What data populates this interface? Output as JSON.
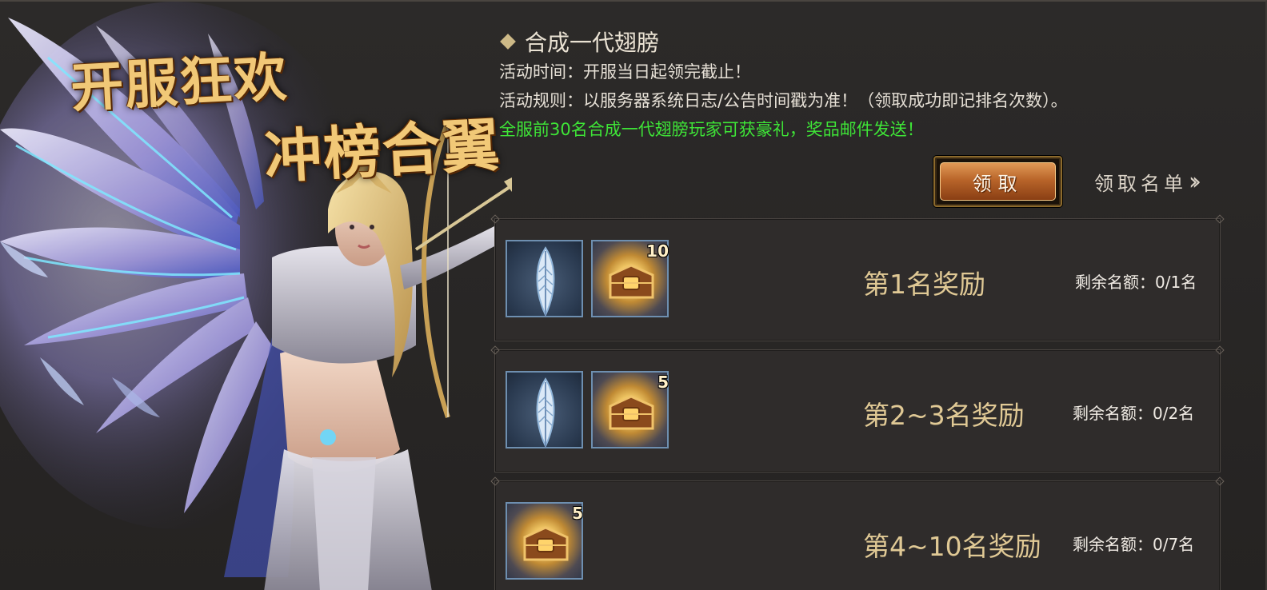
{
  "banner": {
    "line1": "开服狂欢",
    "line2": "冲榜合翼"
  },
  "activity": {
    "title": "合成一代翅膀",
    "time": "活动时间：开服当日起领完截止！",
    "rule": "活动规则：以服务器系统日志/公告时间戳为准！（领取成功即记排名次数）。",
    "reward_note": "全服前30名合成一代翅膀玩家可获豪礼，奖品邮件发送！"
  },
  "actions": {
    "claim_label": "领取",
    "list_label": "领取名单"
  },
  "rewards": [
    {
      "rank_label": "第1名奖励",
      "remaining": "剩余名额：0/1名",
      "items": [
        {
          "icon": "feather-icon",
          "count": ""
        },
        {
          "icon": "treasure-chest-icon",
          "count": "10"
        }
      ]
    },
    {
      "rank_label": "第2~3名奖励",
      "remaining": "剩余名额：0/2名",
      "items": [
        {
          "icon": "feather-icon",
          "count": ""
        },
        {
          "icon": "treasure-chest-icon",
          "count": "5"
        }
      ]
    },
    {
      "rank_label": "第4~10名奖励",
      "remaining": "剩余名额：0/7名",
      "items": [
        {
          "icon": "treasure-chest-icon",
          "count": "5"
        }
      ]
    }
  ],
  "colors": {
    "accent_gold": "#e0c995",
    "notice_green": "#3ee437",
    "button_orange": "#b9652a",
    "slot_border": "#6e8fb0"
  }
}
